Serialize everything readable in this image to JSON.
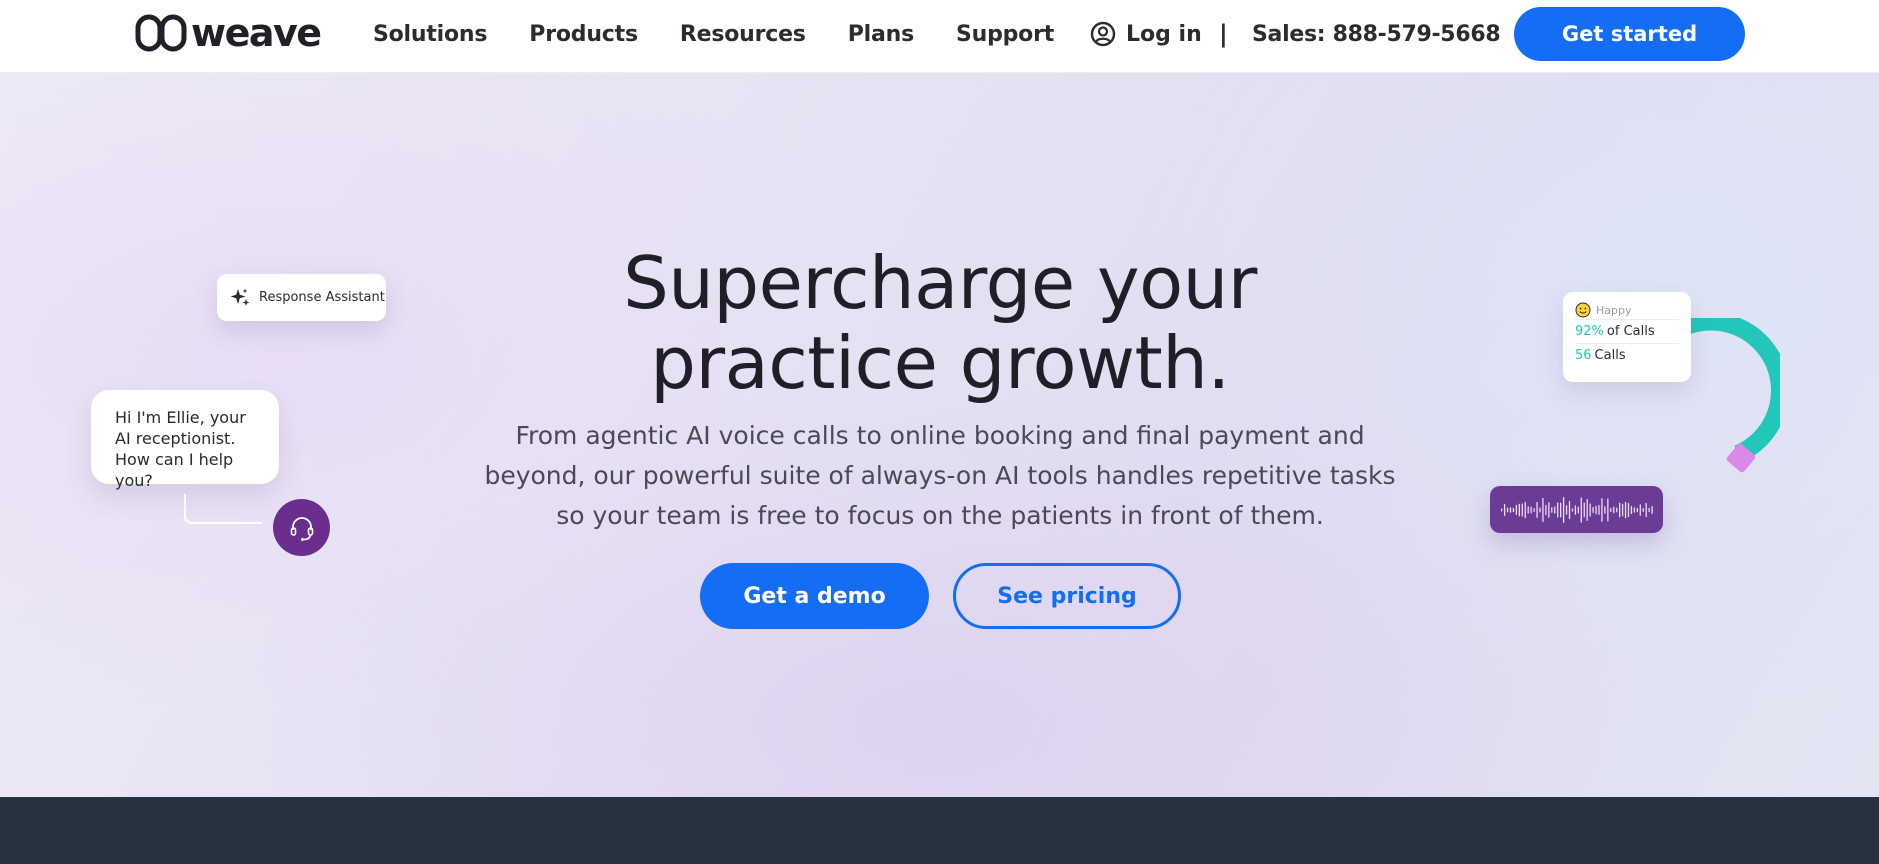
{
  "header": {
    "logo_text": "weave",
    "nav": [
      "Solutions",
      "Products",
      "Resources",
      "Plans",
      "Support"
    ],
    "login_label": "Log in",
    "divider": "|",
    "sales": "Sales: 888-579-5668",
    "cta_label": "Get started"
  },
  "hero": {
    "title_line1": "Supercharge your",
    "title_line2": "practice growth.",
    "subtitle": "From agentic AI voice calls to online booking and final payment and beyond, our powerful suite of always-on AI tools handles repetitive tasks so your team is free to focus on the patients in front of them.",
    "demo_label": "Get a demo",
    "pricing_label": "See pricing"
  },
  "decor": {
    "response_assistant": "Response Assistant",
    "chat_message": "Hi I'm Ellie, your AI receptionist. How can I help you?",
    "stats": {
      "mood": "Happy",
      "percent_value": "92%",
      "percent_label": "of Calls",
      "count_value": "56",
      "count_label": "Calls"
    }
  },
  "colors": {
    "primary": "#146ef5",
    "text": "#202029",
    "purple": "#6b2e8f",
    "teal": "#22c7ba",
    "pink": "#d98ae6",
    "footer": "#26323d"
  },
  "icons": [
    "weave-logo-icon",
    "user-circle-icon",
    "sparkle-icon",
    "headset-icon",
    "smiley-icon",
    "waveform-icon"
  ]
}
